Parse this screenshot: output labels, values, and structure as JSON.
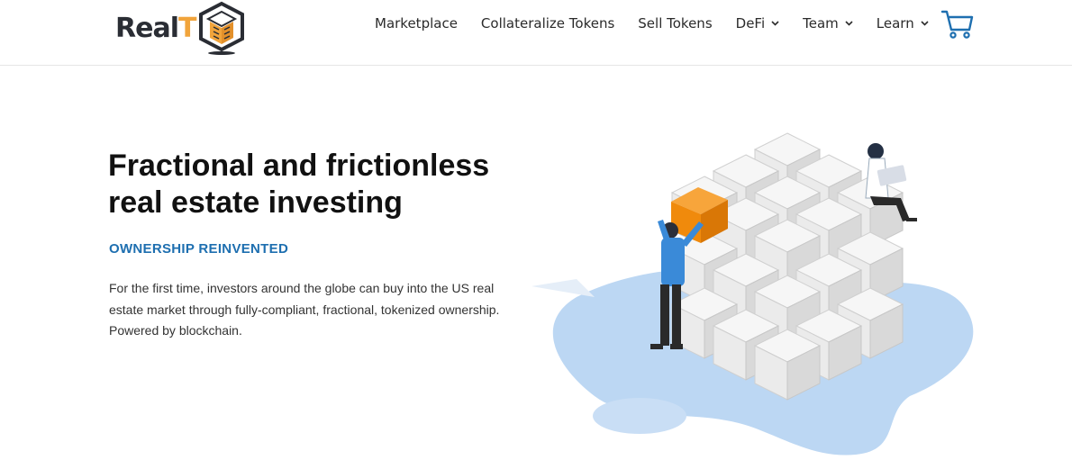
{
  "brand": {
    "name_main": "Real",
    "name_accent": "T"
  },
  "nav": {
    "items": [
      {
        "label": "Marketplace",
        "dropdown": false
      },
      {
        "label": "Collateralize Tokens",
        "dropdown": false
      },
      {
        "label": "Sell Tokens",
        "dropdown": false
      },
      {
        "label": "DeFi",
        "dropdown": true
      },
      {
        "label": "Team",
        "dropdown": true
      },
      {
        "label": "Learn",
        "dropdown": true
      }
    ],
    "cart_icon": "cart-icon"
  },
  "hero": {
    "title": "Fractional and frictionless real estate investing",
    "subtitle": "OWNERSHIP REINVENTED",
    "description": "For the first time, investors around the globe can buy into the US real estate market through fully-compliant, fractional, tokenized ownership. Powered by blockchain."
  },
  "colors": {
    "accent_blue": "#1e6fb0",
    "logo_orange": "#f1a43b",
    "logo_dark": "#2a2d34",
    "blob_blue": "#bcd7f3",
    "cube_orange": "#f08a0c"
  }
}
